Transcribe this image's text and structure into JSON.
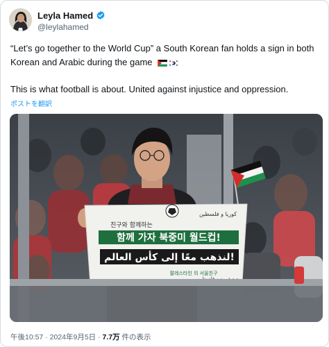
{
  "author": {
    "display_name": "Leyla Hamed",
    "handle": "@leylahamed",
    "verified": true,
    "avatar_icon": "profile-photo"
  },
  "tweet": {
    "text_line1": "“Let’s go together to the World Cup” a South Korean fan holds a sign in both Korean and Arabic during the game",
    "flags": [
      "palestine-flag",
      "south-korea-flag"
    ],
    "text_line2": "This is what football is about. United against injustice and oppression.",
    "translate_label": "ポストを翻訳"
  },
  "photo": {
    "sign_korean_main": "함께 가자 북중미 월드컵!",
    "sign_korean_top": "친구와 함께하는",
    "sign_arabic_top": "كوريا و فلسطين",
    "sign_arabic_main": "لنذهب معًا إلى كأس العالم!",
    "sign_korean_bottom": "팔레스타인 의 서울친구",
    "sign_arabic_bottom": "صديقي من فلسطين"
  },
  "meta": {
    "time": "午後10:57",
    "date": "2024年9月5日",
    "views_count": "7.7万",
    "views_label": "件の表示"
  }
}
